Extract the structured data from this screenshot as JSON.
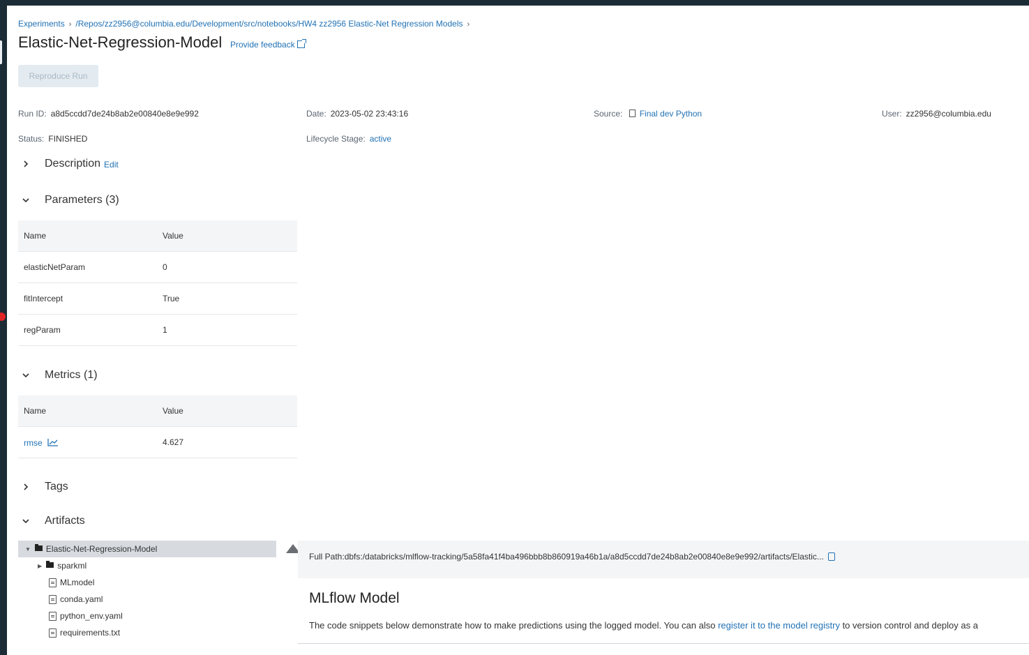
{
  "breadcrumb": {
    "experiments": "Experiments",
    "path": "/Repos/zz2956@columbia.edu/Development/src/notebooks/HW4 zz2956 Elastic-Net Regression Models",
    "sep": "›"
  },
  "header": {
    "title": "Elastic-Net-Regression-Model",
    "feedback": "Provide feedback",
    "reproduce_button": "Reproduce Run"
  },
  "run_info": {
    "run_id_label": "Run ID:",
    "run_id": "a8d5ccdd7de24b8ab2e00840e8e9e992",
    "date_label": "Date:",
    "date": "2023-05-02 23:43:16",
    "source_label": "Source:",
    "source": "Final dev Python",
    "user_label": "User:",
    "user": "zz2956@columbia.edu",
    "status_label": "Status:",
    "status": "FINISHED",
    "lifecycle_label": "Lifecycle Stage:",
    "lifecycle": "active"
  },
  "sections": {
    "description": "Description",
    "description_edit": "Edit",
    "parameters": "Parameters (3)",
    "metrics": "Metrics (1)",
    "tags": "Tags",
    "artifacts": "Artifacts"
  },
  "parameters": {
    "headers": [
      "Name",
      "Value"
    ],
    "rows": [
      {
        "name": "elasticNetParam",
        "value": "0"
      },
      {
        "name": "fitIntercept",
        "value": "True"
      },
      {
        "name": "regParam",
        "value": "1"
      }
    ]
  },
  "metrics": {
    "headers": [
      "Name",
      "Value"
    ],
    "rows": [
      {
        "name": "rmse",
        "value": "4.627"
      }
    ]
  },
  "artifacts": {
    "root": "Elastic-Net-Regression-Model",
    "items": [
      "sparkml",
      "MLmodel",
      "conda.yaml",
      "python_env.yaml",
      "requirements.txt"
    ],
    "full_path": "Full Path:dbfs:/databricks/mlflow-tracking/5a58fa41f4ba496bbb8b860919a46b1a/a8d5ccdd7de24b8ab2e00840e8e9e992/artifacts/Elastic...",
    "mlflow_title": "MLflow Model",
    "desc_before": "The code snippets below demonstrate how to make predictions using the logged model. You can also ",
    "desc_link": "register it to the model registry",
    "desc_after": " to version control and deploy as a"
  },
  "colors": {
    "link": "#2272b4",
    "header_bg": "#f4f5f6",
    "selected_row": "#d7dbe0",
    "chrome": "#1b2c36"
  }
}
